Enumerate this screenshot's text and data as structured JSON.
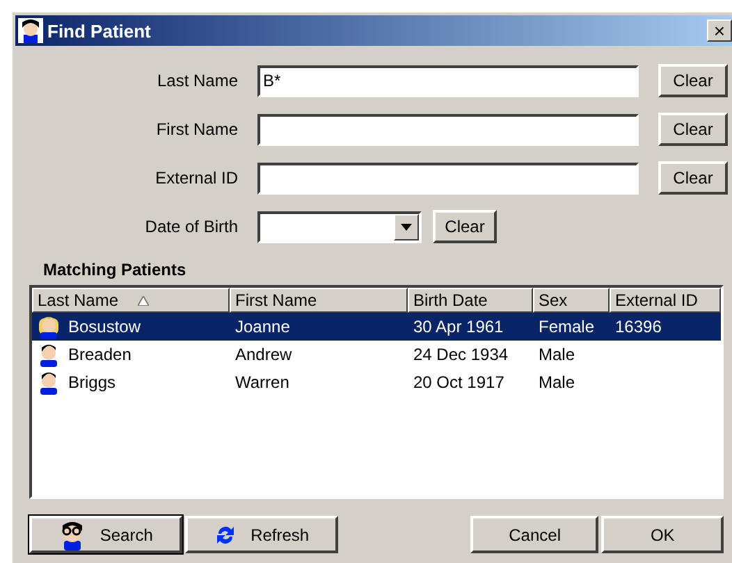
{
  "window": {
    "title": "Find Patient",
    "close": "×"
  },
  "fields": [
    {
      "label": "Last Name",
      "kind": "text",
      "value": "B*",
      "clear": "Clear"
    },
    {
      "label": "First Name",
      "kind": "text",
      "clear": "Clear"
    },
    {
      "label": "External ID",
      "kind": "text",
      "clear": "Clear"
    },
    {
      "label": "Date of Birth",
      "kind": "dropdown",
      "clear": "Clear"
    }
  ],
  "results": {
    "title": "Matching Patients",
    "columns": [
      {
        "label": "Last Name",
        "sorted": true
      },
      {
        "label": "First Name",
        "sorted": false
      },
      {
        "label": "Birth Date",
        "sorted": false
      },
      {
        "label": "Sex",
        "sorted": false
      },
      {
        "label": "External ID",
        "sorted": false
      }
    ],
    "rows": [
      {
        "kind": "female",
        "selected": true,
        "cells": [
          "Bosustow",
          "Joanne",
          "30 Apr 1961",
          "Female",
          "16396"
        ]
      },
      {
        "kind": "male",
        "selected": false,
        "cells": [
          "Breaden",
          "Andrew",
          "24 Dec 1934",
          "Male",
          null
        ]
      },
      {
        "kind": "male",
        "selected": false,
        "cells": [
          "Briggs",
          "Warren",
          "20 Oct 1917",
          "Male",
          null
        ]
      }
    ]
  },
  "buttons": [
    {
      "label": "Search",
      "kind": "search",
      "focused": true
    },
    {
      "label": "Refresh",
      "kind": "refresh",
      "focused": false
    },
    {
      "label": "Cancel",
      "kind": "plain",
      "focused": false
    },
    {
      "label": "OK",
      "kind": "plain",
      "focused": false
    }
  ]
}
